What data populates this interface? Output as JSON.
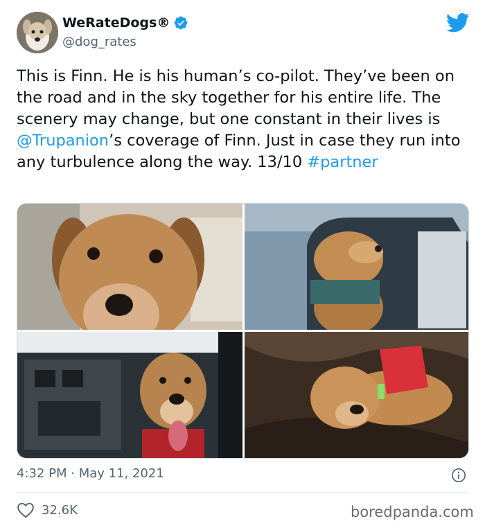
{
  "author": {
    "display_name": "WeRateDogs®",
    "handle": "@dog_rates",
    "verified_icon": "verified-badge-icon",
    "avatar_icon": "dog-avatar"
  },
  "platform_icon": "twitter-bird-icon",
  "tweet": {
    "text_before_mention": "This is Finn. He is his human’s co-pilot. They’ve been on the road and in the sky together for his entire life. The scenery may change, but one constant in their lives is ",
    "mention": "@Trupanion",
    "text_after_mention": "’s coverage of Finn. Just in case they run into any turbulence along the way. 13/10 ",
    "hashtag": "#partner"
  },
  "media": [
    {
      "icon": "puppy-closeup-photo"
    },
    {
      "icon": "dog-in-car-window-photo"
    },
    {
      "icon": "dog-in-cockpit-photo"
    },
    {
      "icon": "dog-on-rocks-photo"
    }
  ],
  "meta": {
    "timestamp": "4:32 PM · May 11, 2021",
    "info_icon": "info-icon"
  },
  "stats": {
    "likes": "32.6K",
    "like_icon": "heart-icon"
  },
  "watermark": "boredpanda.com",
  "colors": {
    "accent": "#1d9bf0",
    "secondary_text": "#536471",
    "divider": "#cfd9de"
  }
}
